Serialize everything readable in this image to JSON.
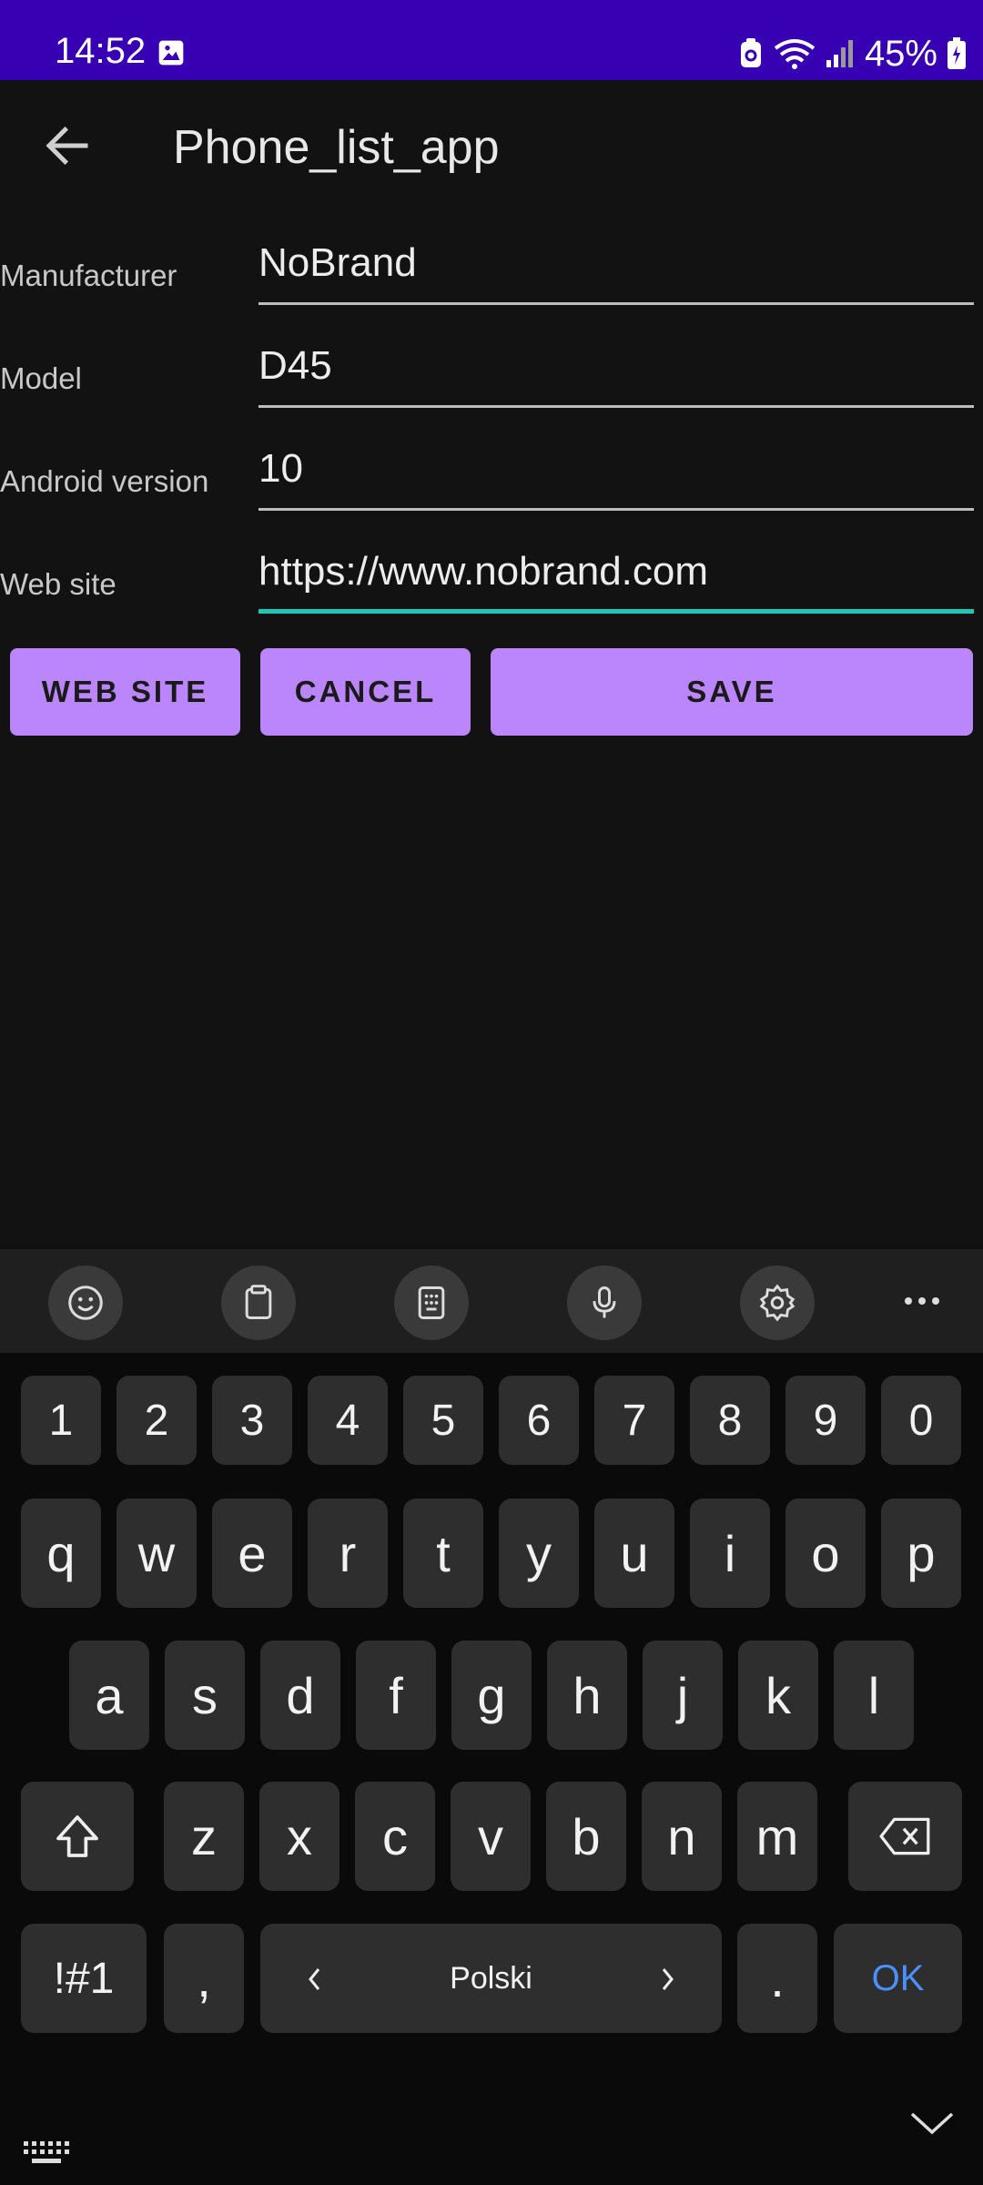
{
  "status_bar": {
    "time": "14:52",
    "battery_percent": "45%",
    "icons": [
      "image-icon",
      "battery-saver-icon",
      "wifi-icon",
      "signal-icon",
      "battery-icon"
    ],
    "background": "#3700b3"
  },
  "app_bar": {
    "title": "Phone_list_app",
    "back_icon": "arrow-back-icon"
  },
  "form": {
    "manufacturer": {
      "label": "Manufacturer",
      "value": "NoBrand"
    },
    "model": {
      "label": "Model",
      "value": "D45"
    },
    "android_version": {
      "label": "Android version",
      "value": "10"
    },
    "web_site": {
      "label": "Web site",
      "value": "https://www.nobrand.com"
    }
  },
  "buttons": {
    "web_site": "WEB SITE",
    "cancel": "CANCEL",
    "save": "SAVE",
    "color": "#bb86fc"
  },
  "keyboard": {
    "toolbar_icons": [
      "emoji-icon",
      "clipboard-icon",
      "keypad-icon",
      "microphone-icon",
      "settings-icon",
      "more-icon"
    ],
    "row_numbers": [
      "1",
      "2",
      "3",
      "4",
      "5",
      "6",
      "7",
      "8",
      "9",
      "0"
    ],
    "row1": [
      "q",
      "w",
      "e",
      "r",
      "t",
      "y",
      "u",
      "i",
      "o",
      "p"
    ],
    "row2": [
      "a",
      "s",
      "d",
      "f",
      "g",
      "h",
      "j",
      "k",
      "l"
    ],
    "row3": [
      "z",
      "x",
      "c",
      "v",
      "b",
      "n",
      "m"
    ],
    "symbols_key": "!#1",
    "comma_key": ",",
    "space_label": "Polski",
    "period_key": ".",
    "ok_key": "OK",
    "accent_color": "#4a90ff"
  }
}
